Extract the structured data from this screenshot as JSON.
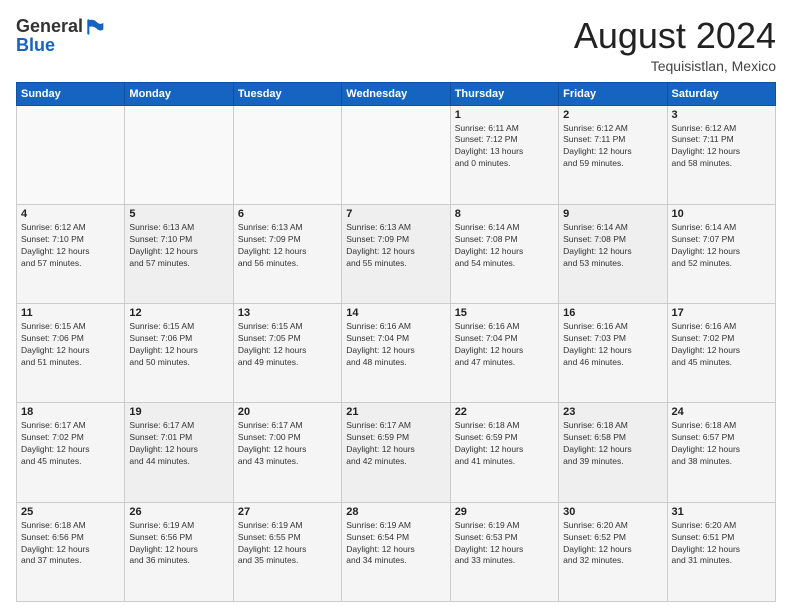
{
  "header": {
    "logo": {
      "general": "General",
      "blue": "Blue",
      "tagline": ""
    },
    "title": "August 2024",
    "location": "Tequisistlan, Mexico"
  },
  "days_of_week": [
    "Sunday",
    "Monday",
    "Tuesday",
    "Wednesday",
    "Thursday",
    "Friday",
    "Saturday"
  ],
  "weeks": [
    [
      {
        "day": "",
        "info": ""
      },
      {
        "day": "",
        "info": ""
      },
      {
        "day": "",
        "info": ""
      },
      {
        "day": "",
        "info": ""
      },
      {
        "day": "1",
        "info": "Sunrise: 6:11 AM\nSunset: 7:12 PM\nDaylight: 13 hours\nand 0 minutes."
      },
      {
        "day": "2",
        "info": "Sunrise: 6:12 AM\nSunset: 7:11 PM\nDaylight: 12 hours\nand 59 minutes."
      },
      {
        "day": "3",
        "info": "Sunrise: 6:12 AM\nSunset: 7:11 PM\nDaylight: 12 hours\nand 58 minutes."
      }
    ],
    [
      {
        "day": "4",
        "info": "Sunrise: 6:12 AM\nSunset: 7:10 PM\nDaylight: 12 hours\nand 57 minutes."
      },
      {
        "day": "5",
        "info": "Sunrise: 6:13 AM\nSunset: 7:10 PM\nDaylight: 12 hours\nand 57 minutes."
      },
      {
        "day": "6",
        "info": "Sunrise: 6:13 AM\nSunset: 7:09 PM\nDaylight: 12 hours\nand 56 minutes."
      },
      {
        "day": "7",
        "info": "Sunrise: 6:13 AM\nSunset: 7:09 PM\nDaylight: 12 hours\nand 55 minutes."
      },
      {
        "day": "8",
        "info": "Sunrise: 6:14 AM\nSunset: 7:08 PM\nDaylight: 12 hours\nand 54 minutes."
      },
      {
        "day": "9",
        "info": "Sunrise: 6:14 AM\nSunset: 7:08 PM\nDaylight: 12 hours\nand 53 minutes."
      },
      {
        "day": "10",
        "info": "Sunrise: 6:14 AM\nSunset: 7:07 PM\nDaylight: 12 hours\nand 52 minutes."
      }
    ],
    [
      {
        "day": "11",
        "info": "Sunrise: 6:15 AM\nSunset: 7:06 PM\nDaylight: 12 hours\nand 51 minutes."
      },
      {
        "day": "12",
        "info": "Sunrise: 6:15 AM\nSunset: 7:06 PM\nDaylight: 12 hours\nand 50 minutes."
      },
      {
        "day": "13",
        "info": "Sunrise: 6:15 AM\nSunset: 7:05 PM\nDaylight: 12 hours\nand 49 minutes."
      },
      {
        "day": "14",
        "info": "Sunrise: 6:16 AM\nSunset: 7:04 PM\nDaylight: 12 hours\nand 48 minutes."
      },
      {
        "day": "15",
        "info": "Sunrise: 6:16 AM\nSunset: 7:04 PM\nDaylight: 12 hours\nand 47 minutes."
      },
      {
        "day": "16",
        "info": "Sunrise: 6:16 AM\nSunset: 7:03 PM\nDaylight: 12 hours\nand 46 minutes."
      },
      {
        "day": "17",
        "info": "Sunrise: 6:16 AM\nSunset: 7:02 PM\nDaylight: 12 hours\nand 45 minutes."
      }
    ],
    [
      {
        "day": "18",
        "info": "Sunrise: 6:17 AM\nSunset: 7:02 PM\nDaylight: 12 hours\nand 45 minutes."
      },
      {
        "day": "19",
        "info": "Sunrise: 6:17 AM\nSunset: 7:01 PM\nDaylight: 12 hours\nand 44 minutes."
      },
      {
        "day": "20",
        "info": "Sunrise: 6:17 AM\nSunset: 7:00 PM\nDaylight: 12 hours\nand 43 minutes."
      },
      {
        "day": "21",
        "info": "Sunrise: 6:17 AM\nSunset: 6:59 PM\nDaylight: 12 hours\nand 42 minutes."
      },
      {
        "day": "22",
        "info": "Sunrise: 6:18 AM\nSunset: 6:59 PM\nDaylight: 12 hours\nand 41 minutes."
      },
      {
        "day": "23",
        "info": "Sunrise: 6:18 AM\nSunset: 6:58 PM\nDaylight: 12 hours\nand 39 minutes."
      },
      {
        "day": "24",
        "info": "Sunrise: 6:18 AM\nSunset: 6:57 PM\nDaylight: 12 hours\nand 38 minutes."
      }
    ],
    [
      {
        "day": "25",
        "info": "Sunrise: 6:18 AM\nSunset: 6:56 PM\nDaylight: 12 hours\nand 37 minutes."
      },
      {
        "day": "26",
        "info": "Sunrise: 6:19 AM\nSunset: 6:56 PM\nDaylight: 12 hours\nand 36 minutes."
      },
      {
        "day": "27",
        "info": "Sunrise: 6:19 AM\nSunset: 6:55 PM\nDaylight: 12 hours\nand 35 minutes."
      },
      {
        "day": "28",
        "info": "Sunrise: 6:19 AM\nSunset: 6:54 PM\nDaylight: 12 hours\nand 34 minutes."
      },
      {
        "day": "29",
        "info": "Sunrise: 6:19 AM\nSunset: 6:53 PM\nDaylight: 12 hours\nand 33 minutes."
      },
      {
        "day": "30",
        "info": "Sunrise: 6:20 AM\nSunset: 6:52 PM\nDaylight: 12 hours\nand 32 minutes."
      },
      {
        "day": "31",
        "info": "Sunrise: 6:20 AM\nSunset: 6:51 PM\nDaylight: 12 hours\nand 31 minutes."
      }
    ]
  ]
}
